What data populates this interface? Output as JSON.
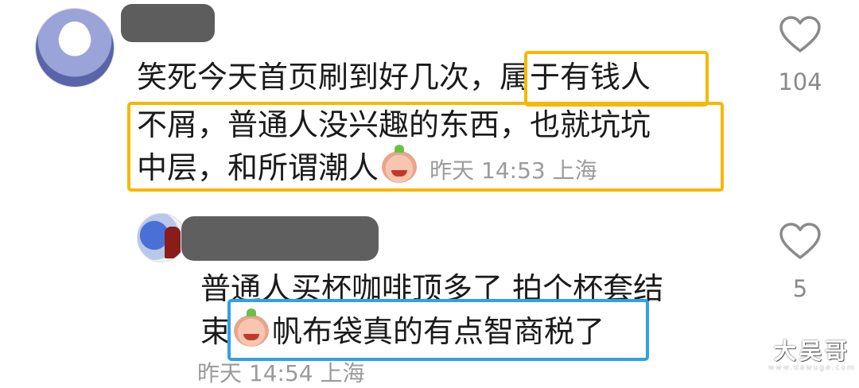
{
  "comment": {
    "line1": "笑死今天首页刷到好几次，属于有钱人",
    "line2": "不屑，普通人没兴趣的东西，也就坑坑",
    "line3": "中层，和所谓潮人",
    "meta": "昨天 14:53 上海",
    "likes": "104"
  },
  "reply": {
    "line1": "普通人买杯咖啡顶多了 拍个杯套结",
    "line2_pre": "束",
    "line2": "帆布袋真的有点智商税了",
    "meta": "昨天 14:54 上海",
    "likes": "5"
  },
  "watermark": {
    "main": "大吴哥",
    "sub": "www.dawuge.com"
  },
  "icons": {
    "like": "heart-outline-icon",
    "emoji1": "crying-laughing-peach-emoji",
    "emoji2": "thinking-peach-emoji"
  },
  "colors": {
    "highlight_yellow": "#f6b800",
    "highlight_blue": "#2ea0ec",
    "meta_gray": "#9b9b9b"
  }
}
